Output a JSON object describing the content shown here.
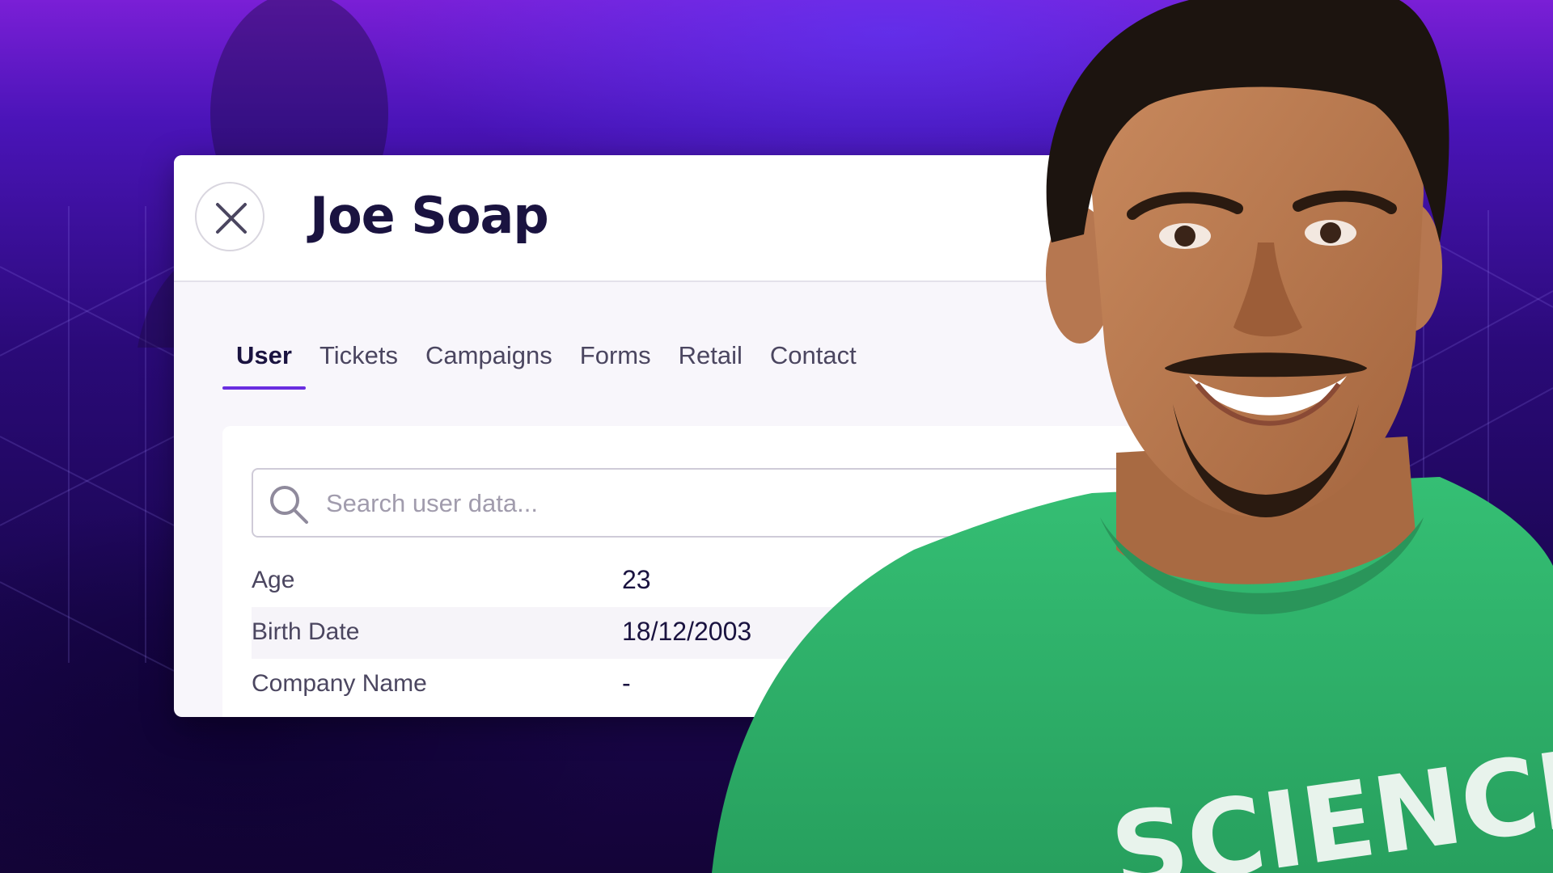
{
  "panel": {
    "title": "Joe Soap",
    "close_icon": "close-icon"
  },
  "tabs": [
    {
      "label": "User",
      "active": true
    },
    {
      "label": "Tickets",
      "active": false
    },
    {
      "label": "Campaigns",
      "active": false
    },
    {
      "label": "Forms",
      "active": false
    },
    {
      "label": "Retail",
      "active": false
    },
    {
      "label": "Contact",
      "active": false
    }
  ],
  "search": {
    "placeholder": "Search user data...",
    "value": "",
    "icon": "search-icon"
  },
  "fields": [
    {
      "label": "Age",
      "value": "23"
    },
    {
      "label": "Birth Date",
      "value": "18/12/2003"
    },
    {
      "label": "Company Name",
      "value": "-"
    }
  ],
  "shirt_text": "SCIENCE",
  "colors": {
    "accent": "#6a2ee0",
    "title": "#1a1340",
    "background_top": "#7a1fd6",
    "background_bottom": "#140438",
    "shirt": "#2fb36a"
  }
}
